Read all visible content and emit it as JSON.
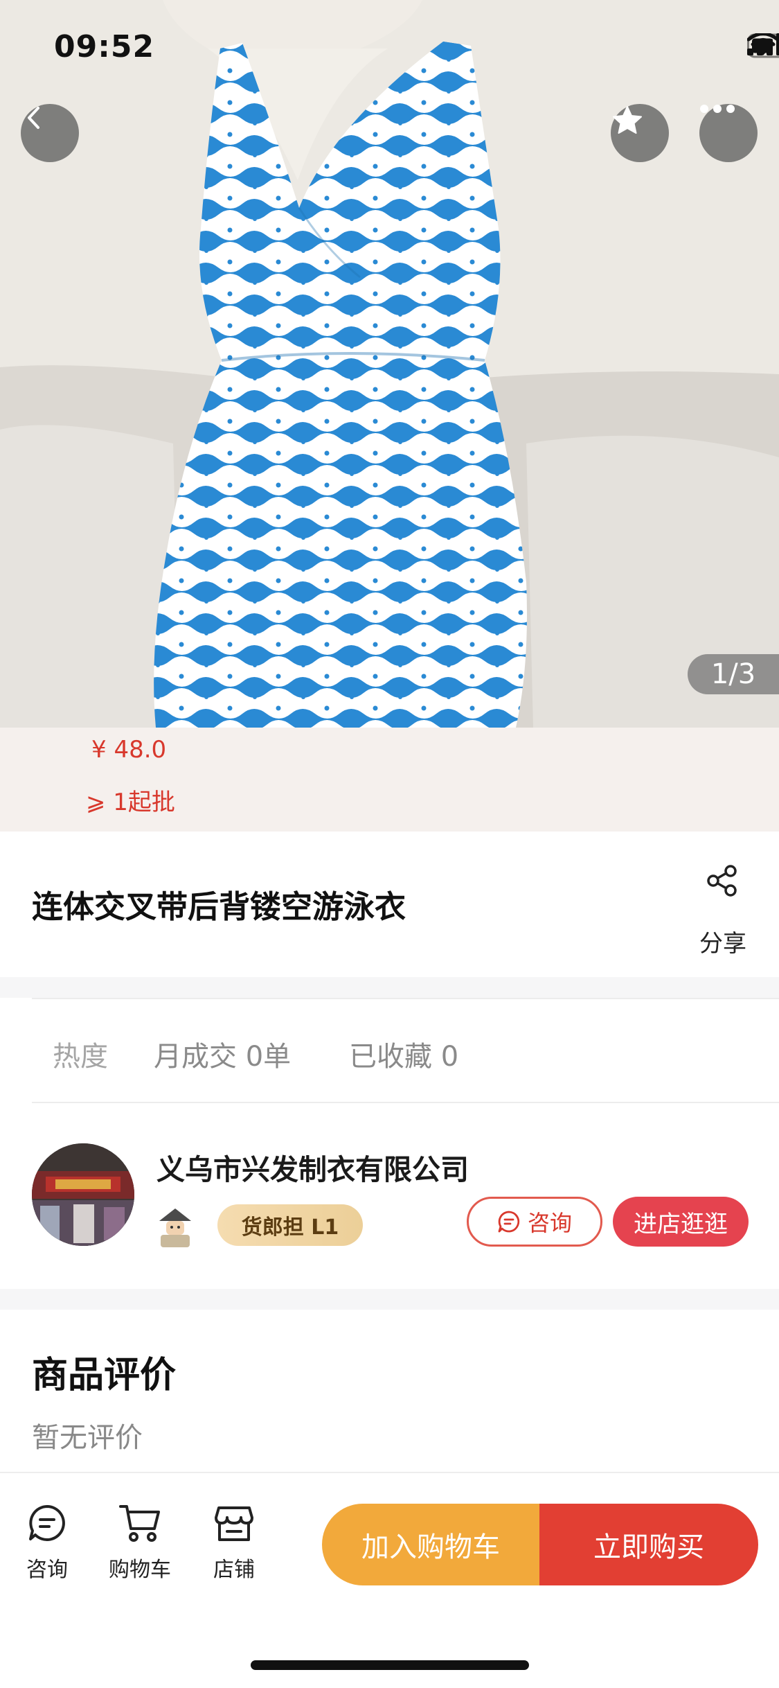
{
  "status_bar": {
    "time": "09:52"
  },
  "gallery": {
    "pager": "1/3",
    "image_description_icon": "swimsuit-photo"
  },
  "price": {
    "value": "¥ 48.0",
    "moq": "⩾ 1起批"
  },
  "product": {
    "title": "连体交叉带后背镂空游泳衣",
    "share_label": "分享"
  },
  "stats": {
    "heat": "热度",
    "monthly": "月成交 0单",
    "favorites": "已收藏 0"
  },
  "shop": {
    "name": "义乌市兴发制衣有限公司",
    "level": "货郎担 L1",
    "consult_label": "咨询",
    "enter_label": "进店逛逛"
  },
  "reviews": {
    "title": "商品评价",
    "empty": "暂无评价"
  },
  "bottom_nav": {
    "consult": "咨询",
    "cart": "购物车",
    "shop": "店铺",
    "add_to_cart": "加入购物车",
    "buy_now": "立即购买"
  },
  "colors": {
    "price_red": "#d8382c",
    "cart_orange": "#f2a93b",
    "buy_red": "#e23f33",
    "swimsuit_blue": "#2a8ad4"
  }
}
